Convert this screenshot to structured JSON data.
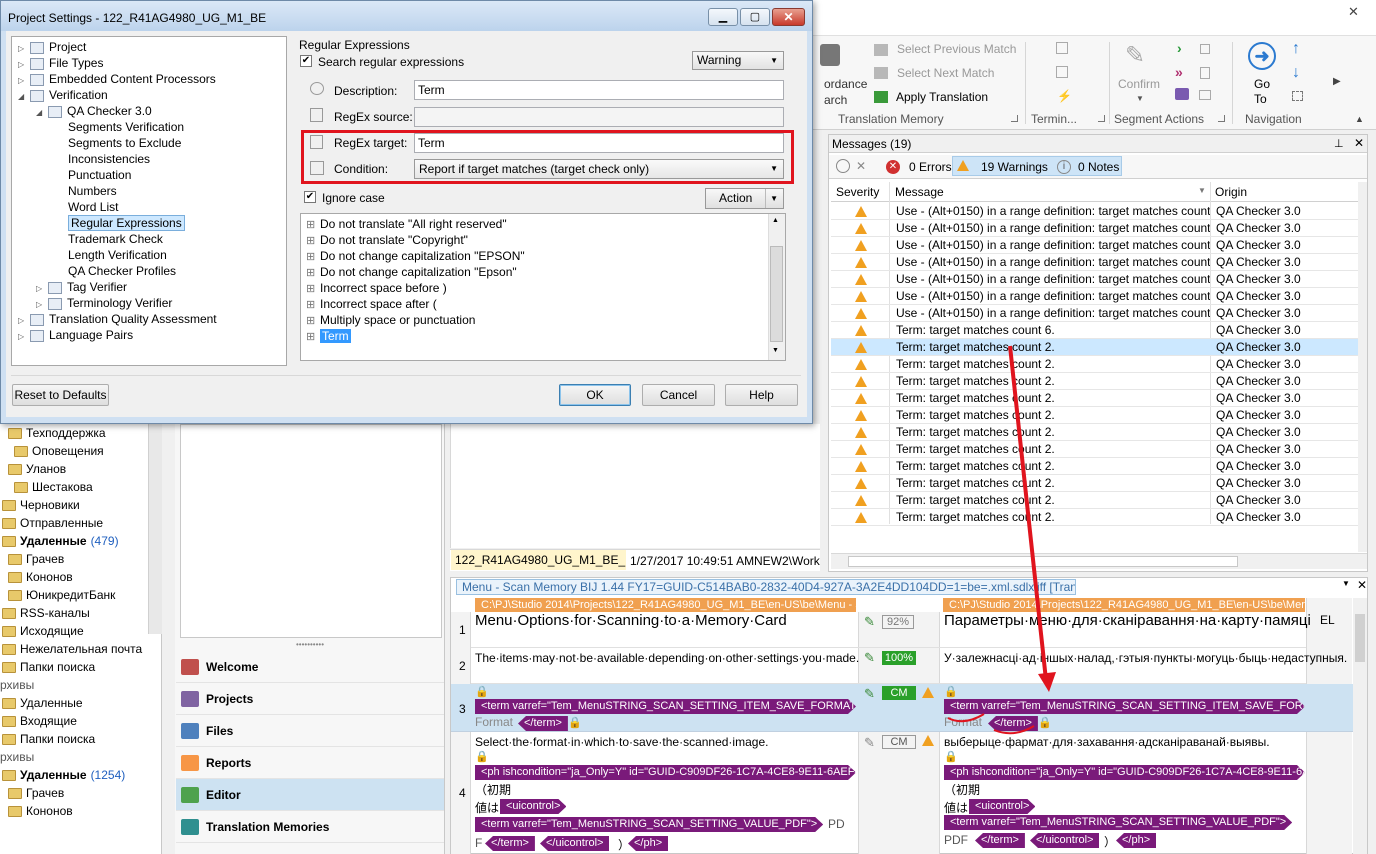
{
  "dialog": {
    "title": "Project Settings - 122_R41AG4980_UG_M1_BE",
    "tree": [
      {
        "label": "Project",
        "indent": 0
      },
      {
        "label": "File Types",
        "indent": 0
      },
      {
        "label": "Embedded Content Processors",
        "indent": 0
      },
      {
        "label": "Verification",
        "indent": 0
      },
      {
        "label": "QA Checker 3.0",
        "indent": 1
      },
      {
        "label": "Segments Verification",
        "indent": 2
      },
      {
        "label": "Segments to Exclude",
        "indent": 2
      },
      {
        "label": "Inconsistencies",
        "indent": 2
      },
      {
        "label": "Punctuation",
        "indent": 2
      },
      {
        "label": "Numbers",
        "indent": 2
      },
      {
        "label": "Word List",
        "indent": 2
      },
      {
        "label": "Regular Expressions",
        "indent": 2
      },
      {
        "label": "Trademark Check",
        "indent": 2
      },
      {
        "label": "Length Verification",
        "indent": 2
      },
      {
        "label": "QA Checker Profiles",
        "indent": 2
      },
      {
        "label": "Tag Verifier",
        "indent": 1
      },
      {
        "label": "Terminology Verifier",
        "indent": 1
      },
      {
        "label": "Translation Quality Assessment",
        "indent": 0
      },
      {
        "label": "Language Pairs",
        "indent": 0
      }
    ],
    "section_title": "Regular Expressions",
    "search_label": "Search regular expressions",
    "severity_value": "Warning",
    "description_label": "Description:",
    "description_value": "Term",
    "regex_source_label": "RegEx source:",
    "regex_source_value": "",
    "regex_target_label": "RegEx target:",
    "regex_target_value": "Term",
    "condition_label": "Condition:",
    "condition_value": "Report if target matches (target check only)",
    "ignore_case_label": "Ignore case",
    "action_label": "Action",
    "rules": [
      "Do not translate \"All right reserved\"",
      "Do not translate \"Copyright\"",
      "Do not change capitalization \"EPSON\"",
      "Do not change capitalization \"Epson\"",
      "Incorrect space before )",
      "Incorrect space after (",
      "Multiply space or punctuation",
      "Term"
    ],
    "reset_label": "Reset to Defaults",
    "ok_label": "OK",
    "cancel_label": "Cancel",
    "help_label": "Help"
  },
  "ribbon": {
    "select_prev": "Select Previous Match",
    "select_next": "Select Next Match",
    "apply_translation": "Apply Translation",
    "tm_group": "Translation Memory",
    "termin_group": "Termin...",
    "confirm": "Confirm",
    "seg_actions_group": "Segment Actions",
    "go_to": "Go To",
    "nav_group": "Navigation",
    "ordance": "ordance",
    "arch": "arch"
  },
  "messages": {
    "title": "Messages (19)",
    "errors": "0 Errors",
    "warnings": "19 Warnings",
    "notes": "0 Notes",
    "col_severity": "Severity",
    "col_message": "Message",
    "col_origin": "Origin",
    "rows": [
      {
        "msg": "Use - (Alt+0150) in a range definition: target matches count 1.",
        "origin": "QA Checker 3.0"
      },
      {
        "msg": "Use - (Alt+0150) in a range definition: target matches count 1.",
        "origin": "QA Checker 3.0"
      },
      {
        "msg": "Use - (Alt+0150) in a range definition: target matches count 1.",
        "origin": "QA Checker 3.0"
      },
      {
        "msg": "Use - (Alt+0150) in a range definition: target matches count 1.",
        "origin": "QA Checker 3.0"
      },
      {
        "msg": "Use - (Alt+0150) in a range definition: target matches count 1.",
        "origin": "QA Checker 3.0"
      },
      {
        "msg": "Use - (Alt+0150) in a range definition: target matches count 1.",
        "origin": "QA Checker 3.0"
      },
      {
        "msg": "Use - (Alt+0150) in a range definition: target matches count 1.",
        "origin": "QA Checker 3.0"
      },
      {
        "msg": "Term: target matches count 6.",
        "origin": "QA Checker 3.0"
      },
      {
        "msg": "Term: target matches count 2.",
        "origin": "QA Checker 3.0"
      },
      {
        "msg": "Term: target matches count 2.",
        "origin": "QA Checker 3.0"
      },
      {
        "msg": "Term: target matches count 2.",
        "origin": "QA Checker 3.0"
      },
      {
        "msg": "Term: target matches count 2.",
        "origin": "QA Checker 3.0"
      },
      {
        "msg": "Term: target matches count 2.",
        "origin": "QA Checker 3.0"
      },
      {
        "msg": "Term: target matches count 2.",
        "origin": "QA Checker 3.0"
      },
      {
        "msg": "Term: target matches count 2.",
        "origin": "QA Checker 3.0"
      },
      {
        "msg": "Term: target matches count 2.",
        "origin": "QA Checker 3.0"
      },
      {
        "msg": "Term: target matches count 2.",
        "origin": "QA Checker 3.0"
      },
      {
        "msg": "Term: target matches count 2.",
        "origin": "QA Checker 3.0"
      },
      {
        "msg": "Term: target matches count 2.",
        "origin": "QA Checker 3.0"
      }
    ]
  },
  "filebar": {
    "file": "122_R41AG4980_UG_M1_BE_Ep",
    "date": "1/27/2017 10:49:51 AM",
    "path": "NEW2\\Work"
  },
  "editor": {
    "doc_title": "Menu - Scan Memory BIJ 1.44 FY17=GUID-C514BAB0-2832-40D4-927A-3A2E4DD104DD=1=be=.xml.sdlxliff [Translation]",
    "src_path": "C:\\PJ\\Studio 2014\\Projects\\122_R41AG4980_UG_M1_BE\\en-US\\be\\Menu - S",
    "tgt_path": "C:\\PJ\\Studio 2014\\Projects\\122_R41AG4980_UG_M1_BE\\en-US\\be\\Menu",
    "lang_code": "EL",
    "seg1_src": "Menu·Options·for·Scanning·to·a·Memory·Card",
    "seg1_status": "92%",
    "seg1_tgt": "Параметры·меню·для·сканіравання·на·карту·памяці",
    "seg2_src": "The·items·may·not·be·available·depending·on·other·settings·you·made.",
    "seg2_status": "100%",
    "seg2_tgt": "У·залежнасці·ад·іншых·налад,·гэтыя·пункты·могуць·быць·недаступныя.",
    "seg3_tag": "<term varref=\"Tem_MenuSTRING_SCAN_SETTING_ITEM_SAVE_FORMAT",
    "seg3_tag_tgt": "<term varref=\"Tem_MenuSTRING_SCAN_SETTING_ITEM_SAVE_FORM",
    "seg3_word": "Format",
    "seg3_endtag": "</term>",
    "seg3_status": "CM",
    "seg4_src": "Select·the·format·in·which·to·save·the·scanned·image.",
    "seg4_status": "CM",
    "seg4_tgt": "выберыце·фармат·для·захавання·адсканіраванай·выявы.",
    "seg4_ph": "<ph ishcondition=\"ja_Only=Y\" id=\"GUID-C909DF26-1C7A-4CE8-9E11-6AEF4",
    "seg4_ph_tgt": "<ph ishcondition=\"ja_Only=Y\" id=\"GUID-C909DF26-1C7A-4CE8-9E11-6A",
    "seg4_jp1": "（初期",
    "seg4_jp2": "値は",
    "seg4_uic": "<uicontrol>",
    "seg4_term": "<term varref=\"Tem_MenuSTRING_SCAN_SETTING_VALUE_PDF\">",
    "seg4_pdf": "PD",
    "seg4_pdf_tgt": "PDF",
    "seg4_f": "F",
    "seg4_endterm": "</term>",
    "seg4_enduic": "</uicontrol>",
    "seg4_paren": "）",
    "seg4_endph": "</ph>",
    "seg_numbers": [
      "1",
      "2",
      "3",
      "4"
    ]
  },
  "nav": {
    "items": [
      "Welcome",
      "Projects",
      "Files",
      "Reports",
      "Editor",
      "Translation Memories"
    ],
    "colors": [
      "#c0504d",
      "#8064a2",
      "#4f81bd",
      "#f79646",
      "#4ea24e",
      "#2f8f8f"
    ]
  },
  "mail": {
    "items": [
      {
        "label": "Техподдержка",
        "indent": 1,
        "count": ""
      },
      {
        "label": "Оповещения",
        "indent": 2,
        "count": ""
      },
      {
        "label": "Уланов",
        "indent": 1,
        "count": ""
      },
      {
        "label": "Шестакова",
        "indent": 2,
        "count": ""
      },
      {
        "label": "Черновики",
        "indent": 0,
        "count": ""
      },
      {
        "label": "Отправленные",
        "indent": 0,
        "count": ""
      },
      {
        "label": "Удаленные",
        "indent": 0,
        "count": "(479)"
      },
      {
        "label": "Грачев",
        "indent": 1,
        "count": ""
      },
      {
        "label": "Кононов",
        "indent": 1,
        "count": ""
      },
      {
        "label": "ЮникредитБанк",
        "indent": 1,
        "count": ""
      },
      {
        "label": "RSS-каналы",
        "indent": 0,
        "count": ""
      },
      {
        "label": "Исходящие",
        "indent": 0,
        "count": ""
      },
      {
        "label": "Нежелательная почта",
        "indent": 0,
        "count": ""
      },
      {
        "label": "Папки поиска",
        "indent": 0,
        "count": ""
      },
      {
        "label": "рхивы",
        "indent": -1,
        "count": ""
      },
      {
        "label": "Удаленные",
        "indent": 0,
        "count": ""
      },
      {
        "label": "Входящие",
        "indent": 0,
        "count": ""
      },
      {
        "label": "Папки поиска",
        "indent": 0,
        "count": ""
      },
      {
        "label": "рхивы",
        "indent": -1,
        "count": ""
      },
      {
        "label": "Удаленные",
        "indent": 0,
        "count": "(1254)"
      },
      {
        "label": "Грачев",
        "indent": 1,
        "count": ""
      },
      {
        "label": "Кононов",
        "indent": 1,
        "count": ""
      }
    ]
  },
  "accent": {
    "highlight_red": "#e0141e",
    "selection_blue": "#cce8ff",
    "tag_purple": "#7a1a7a",
    "path_orange": "#f0a050"
  }
}
